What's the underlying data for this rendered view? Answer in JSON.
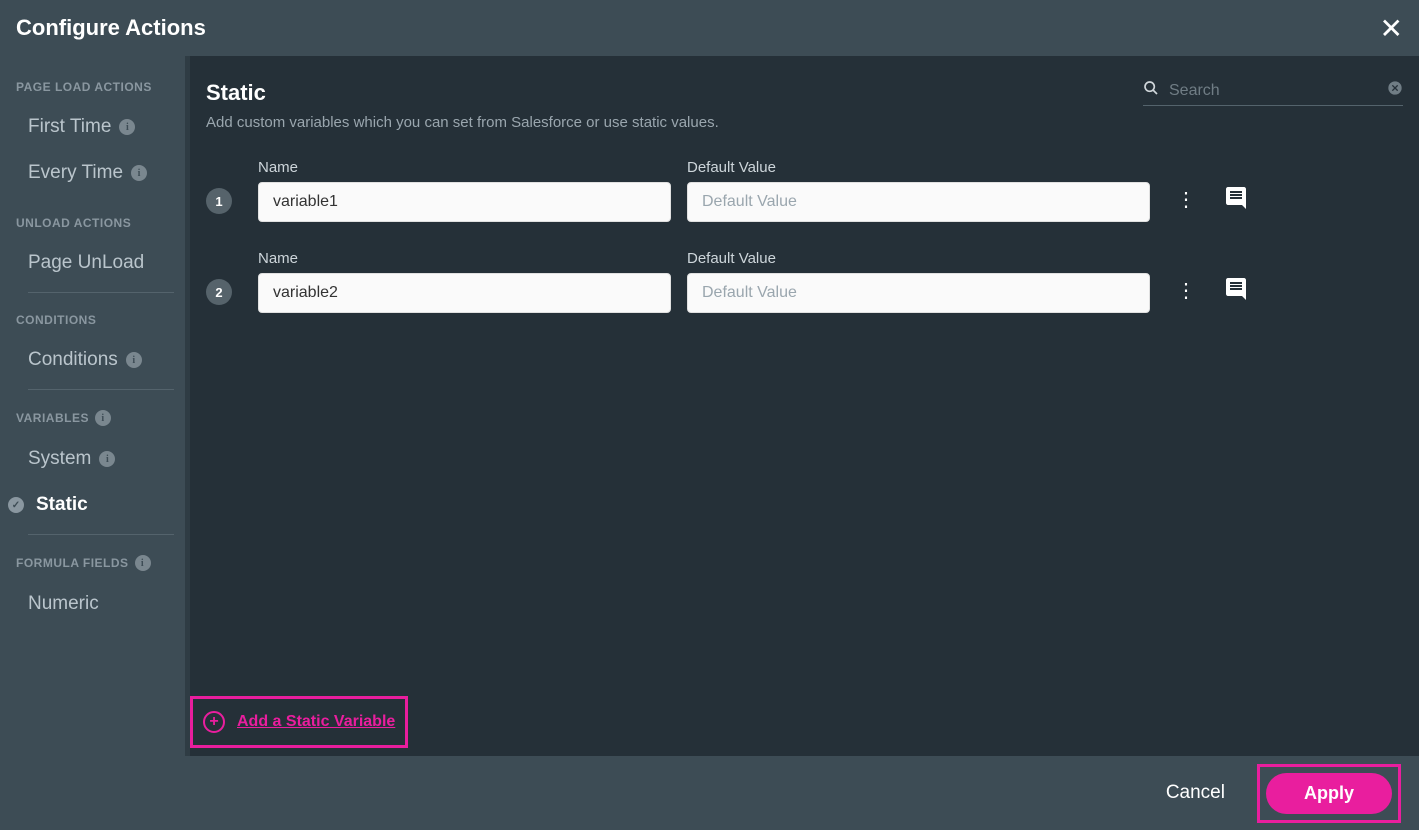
{
  "header": {
    "title": "Configure Actions"
  },
  "sidebar": {
    "groups": [
      {
        "label": "PAGE LOAD ACTIONS",
        "items": [
          {
            "label": "First Time",
            "info": true
          },
          {
            "label": "Every Time",
            "info": true
          }
        ]
      },
      {
        "label": "UNLOAD ACTIONS",
        "items": [
          {
            "label": "Page UnLoad"
          }
        ]
      },
      {
        "label": "CONDITIONS",
        "items": [
          {
            "label": "Conditions",
            "info": true
          }
        ]
      },
      {
        "label": "VARIABLES",
        "info": true,
        "items": [
          {
            "label": "System",
            "info": true
          },
          {
            "label": "Static",
            "active": true
          }
        ]
      },
      {
        "label": "FORMULA FIELDS",
        "info": true,
        "items": [
          {
            "label": "Numeric"
          }
        ]
      }
    ]
  },
  "main": {
    "title": "Static",
    "subtitle": "Add custom variables which you can set from Salesforce or use static values.",
    "search_placeholder": "Search",
    "name_label": "Name",
    "value_label": "Default Value",
    "value_placeholder": "Default Value",
    "rows": [
      {
        "num": "1",
        "name": "variable1",
        "value": ""
      },
      {
        "num": "2",
        "name": "variable2",
        "value": ""
      }
    ],
    "add_label": "Add a Static Variable"
  },
  "footer": {
    "cancel": "Cancel",
    "apply": "Apply"
  }
}
